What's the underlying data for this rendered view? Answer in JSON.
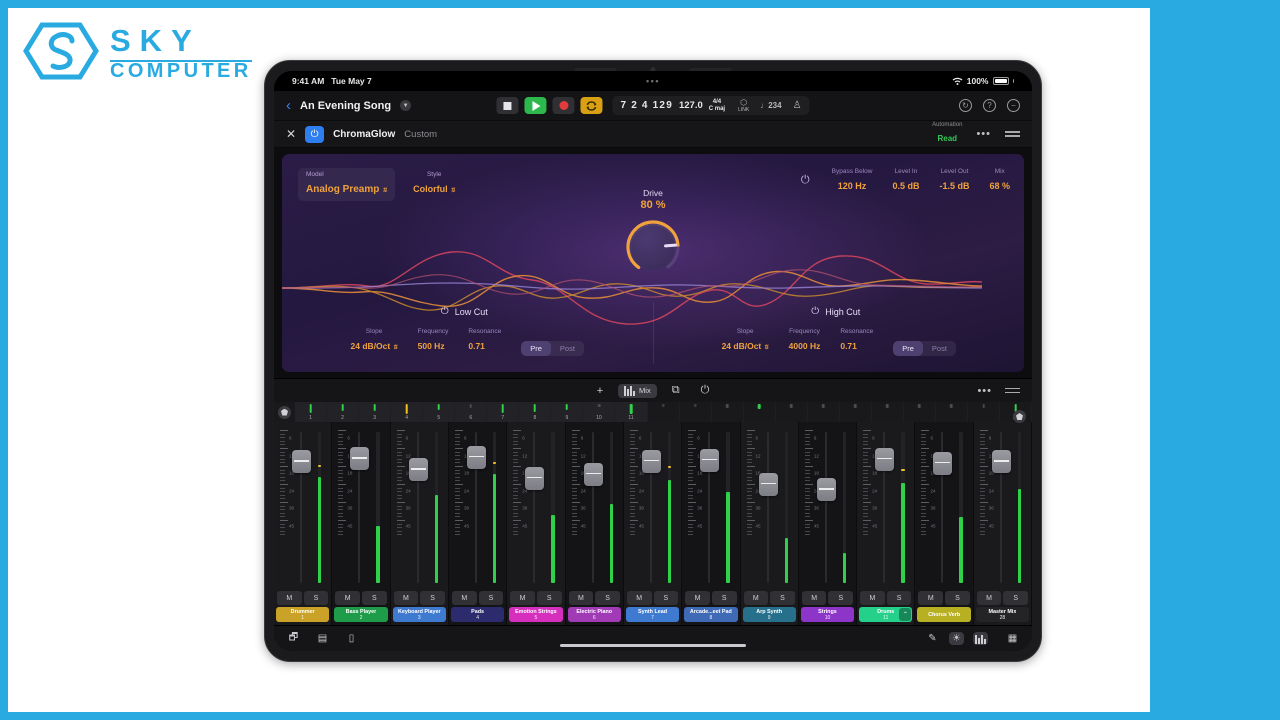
{
  "brand": {
    "name": "SKY",
    "sub": "COMPUTER",
    "color": "#29abe2"
  },
  "status_bar": {
    "time": "9:41 AM",
    "date": "Tue May 7",
    "battery": "100%",
    "wifi_icon": "wifi-icon",
    "battery_icon": "battery-icon"
  },
  "toolbar": {
    "back_icon": "chevron-left-icon",
    "song_title": "An Evening Song",
    "title_chevron_icon": "chevron-down-icon",
    "stop_label": "stop-button",
    "play_label": "play-button",
    "record_label": "record-button",
    "cycle_label": "cycle-button",
    "position": "7 2 4 129",
    "tempo": "127.0",
    "time_signature": "4/4",
    "key": "C maj",
    "link_label": "LINK",
    "count_in": "♩234",
    "metronome_icon": "metronome-icon",
    "right_icons": [
      "help-icon",
      "question-icon",
      "minus-icon"
    ]
  },
  "plugin": {
    "close_icon": "close-icon",
    "power_icon": "power-icon",
    "name": "ChromaGlow",
    "preset": "Custom",
    "automation_label": "Automation",
    "automation_value": "Read",
    "automation_color": "#35c759",
    "more_icon": "more-icon",
    "list_icon": "list-icon",
    "model_label": "Model",
    "model_value": "Analog Preamp",
    "style_label": "Style",
    "style_value": "Colorful",
    "bypass_label": "Bypass Below",
    "bypass_value": "120 Hz",
    "level_in_label": "Level In",
    "level_in_value": "0.5 dB",
    "level_out_label": "Level Out",
    "level_out_value": "-1.5 dB",
    "mix_label": "Mix",
    "mix_value": "68 %",
    "drive_label": "Drive",
    "drive_value": "80 %",
    "drive_percent": 80,
    "accent_color": "#f0a23c",
    "low_cut": {
      "title": "Low Cut",
      "power_icon": "power-icon",
      "slope_label": "Slope",
      "slope_value": "24 dB/Oct",
      "freq_label": "Frequency",
      "freq_value": "500 Hz",
      "res_label": "Resonance",
      "res_value": "0.71",
      "pre_label": "Pre",
      "post_label": "Post",
      "selected": "Pre"
    },
    "high_cut": {
      "title": "High Cut",
      "power_icon": "power-icon",
      "slope_label": "Slope",
      "slope_value": "24 dB/Oct",
      "freq_label": "Frequency",
      "freq_value": "4000 Hz",
      "res_label": "Resonance",
      "res_value": "0.71",
      "pre_label": "Pre",
      "post_label": "Post",
      "selected": "Pre"
    }
  },
  "mix_toolbar": {
    "add_label": "+",
    "mix_label": "Mix",
    "faders_icon": "faders-icon",
    "duplicate_icon": "duplicate-icon",
    "power_icon": "power-icon",
    "more_icon": "more-icon",
    "list_icon": "list-icon"
  },
  "overview": {
    "button_icon": "shield-icon",
    "cells": [
      {
        "num": "1",
        "h": 9,
        "color": "#2fd14a"
      },
      {
        "num": "2",
        "h": 7,
        "color": "#2fd14a"
      },
      {
        "num": "3",
        "h": 7,
        "color": "#2fd14a"
      },
      {
        "num": "4",
        "h": 10,
        "color": "#f2c21c"
      },
      {
        "num": "5",
        "h": 6,
        "color": "#2fd14a"
      },
      {
        "num": "6",
        "h": 4,
        "color": "#4a4a50"
      },
      {
        "num": "7",
        "h": 9,
        "color": "#2fd14a"
      },
      {
        "num": "8",
        "h": 8,
        "color": "#2fd14a"
      },
      {
        "num": "9",
        "h": 6,
        "color": "#2fd14a"
      },
      {
        "num": "10",
        "h": 3,
        "color": "#4a4a50"
      },
      {
        "num": "11",
        "h": 10,
        "color": "#2fd14a"
      },
      {
        "num": "",
        "h": 3,
        "color": "#3a3a40"
      },
      {
        "num": "",
        "h": 3,
        "color": "#3a3a40"
      },
      {
        "num": "",
        "h": 4,
        "color": "#4a4a50"
      },
      {
        "num": "",
        "h": 5,
        "color": "#2fd14a"
      },
      {
        "num": "",
        "h": 4,
        "color": "#4a4a50"
      },
      {
        "num": "",
        "h": 4,
        "color": "#4a4a50"
      },
      {
        "num": "",
        "h": 4,
        "color": "#4a4a50"
      },
      {
        "num": "",
        "h": 4,
        "color": "#4a4a50"
      },
      {
        "num": "",
        "h": 4,
        "color": "#4a4a50"
      },
      {
        "num": "",
        "h": 4,
        "color": "#4a4a50"
      },
      {
        "num": "",
        "h": 4,
        "color": "#4a4a50"
      },
      {
        "num": "28",
        "h": 8,
        "color": "#2fd14a"
      }
    ]
  },
  "mixer": {
    "scale_ticks": [
      "6",
      "12",
      "18",
      "24",
      "36",
      "45"
    ],
    "mute_label": "M",
    "solo_label": "S",
    "master_handle_icon": "shield-icon",
    "chevron_icon": "chevron-up-icon",
    "strips": [
      {
        "name": "Drummer",
        "num": "1",
        "color": "#c9a227",
        "fader": 26,
        "meter": 70,
        "peak": 77,
        "chevron": false
      },
      {
        "name": "Bass Player",
        "num": "2",
        "color": "#1f9c4a",
        "fader": 22,
        "meter": 38,
        "peak": 0,
        "chevron": false
      },
      {
        "name": "Keyboard Player",
        "num": "3",
        "color": "#3f7ad1",
        "fader": 36,
        "meter": 58,
        "peak": 0,
        "chevron": false
      },
      {
        "name": "Pads",
        "num": "4",
        "color": "#2b2b6e",
        "fader": 20,
        "meter": 72,
        "peak": 79,
        "chevron": false
      },
      {
        "name": "Emotion Strings",
        "num": "5",
        "color": "#d62fbe",
        "fader": 47,
        "meter": 45,
        "peak": 0,
        "chevron": false
      },
      {
        "name": "Electric Piano",
        "num": "6",
        "color": "#a03ab5",
        "fader": 42,
        "meter": 52,
        "peak": 0,
        "chevron": false
      },
      {
        "name": "Synth Lead",
        "num": "7",
        "color": "#3f7ad1",
        "fader": 25,
        "meter": 68,
        "peak": 76,
        "chevron": false
      },
      {
        "name": "Arcade...eet Pad",
        "num": "8",
        "color": "#3f6ab5",
        "fader": 24,
        "meter": 60,
        "peak": 0,
        "chevron": false
      },
      {
        "name": "Arp Synth",
        "num": "9",
        "color": "#27708c",
        "fader": 55,
        "meter": 30,
        "peak": 0,
        "chevron": false
      },
      {
        "name": "Strings",
        "num": "10",
        "color": "#8e35c9",
        "fader": 62,
        "meter": 20,
        "peak": 0,
        "chevron": false
      },
      {
        "name": "Drums",
        "num": "11",
        "color": "#25d08a",
        "fader": 23,
        "meter": 66,
        "peak": 74,
        "chevron": true
      },
      {
        "name": "Chorus Verb",
        "num": "",
        "color": "#b8b023",
        "fader": 28,
        "meter": 44,
        "peak": 0,
        "chevron": false
      },
      {
        "name": "Master Mix",
        "num": "28",
        "color": "#242427",
        "fader": 26,
        "meter": 62,
        "peak": 0,
        "chevron": false
      }
    ]
  },
  "bottom_bar": {
    "left_icons": [
      "loops-browser-icon",
      "library-icon",
      "notes-icon"
    ],
    "pencil_icon": "pencil-icon",
    "settings_icon": "settings-icon",
    "mixer_icon": "mixer-icon",
    "keyboard_icon": "keyboard-icon"
  }
}
